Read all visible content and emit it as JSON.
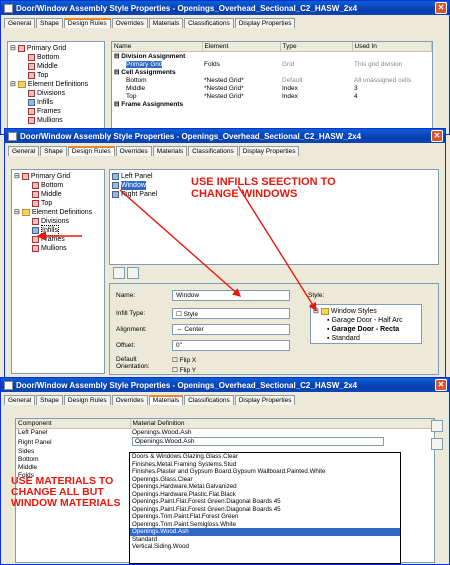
{
  "win1": {
    "title": "Door/Window Assembly Style Properties - Openings_Overhead_Sectional_C2_HASW_2x4",
    "tabs": [
      "General",
      "Shape",
      "Design Rules",
      "Overrides",
      "Materials",
      "Classifications",
      "Display Properties"
    ],
    "tree": [
      "Primary Grid",
      "Bottom",
      "Middle",
      "Top",
      "Element Definitions",
      "Divisions",
      "Infills",
      "Frames",
      "Mullions"
    ],
    "cols": [
      "Name",
      "Element",
      "Type",
      "Used In"
    ],
    "rows": [
      [
        "Division Assignment",
        "",
        "",
        ""
      ],
      [
        "Primary Grid",
        "Folds",
        "Grid",
        "This grid division"
      ],
      [
        "Cell Assignments",
        "",
        "",
        ""
      ],
      [
        "Bottom",
        "*Nested Grid*",
        "Default",
        "All unassigned cells"
      ],
      [
        "Middle",
        "*Nested Grid*",
        "Index",
        "3"
      ],
      [
        "Top",
        "*Nested Grid*",
        "Index",
        "4"
      ],
      [
        "Frame Assignments",
        "",
        "",
        ""
      ]
    ]
  },
  "win2": {
    "title": "Door/Window Assembly Style Properties - Openings_Overhead_Sectional_C2_HASW_2x4",
    "tabs": [
      "General",
      "Shape",
      "Design Rules",
      "Overrides",
      "Materials",
      "Classifications",
      "Display Properties"
    ],
    "tree": [
      "Primary Grid",
      "Bottom",
      "Middle",
      "Top",
      "Element Definitions",
      "Divisions",
      "Infills",
      "Frames",
      "Mullions"
    ],
    "infills": [
      "Left Panel",
      "Window",
      "Right Panel"
    ],
    "note": "USE INFILLS SEECTION TO CHANGE WINDOWS",
    "form": {
      "name_label": "Name:",
      "name": "Window",
      "type_label": "Infill Type:",
      "type": "Style",
      "align_label": "Alignment:",
      "align": "Center",
      "offset_label": "Offset:",
      "offset": "0\"",
      "orient_label": "Default Orientation:",
      "flipx": "Flip X",
      "flipy": "Flip Y",
      "style_label": "Style:"
    },
    "styles": [
      "Window Styles",
      "Garage Door - Half Arc",
      "Garage Door - Recta",
      "Standard"
    ]
  },
  "win3": {
    "title": "Door/Window Assembly Style Properties - Openings_Overhead_Sectional_C2_HASW_2x4",
    "tabs": [
      "General",
      "Shape",
      "Design Rules",
      "Overrides",
      "Materials",
      "Classifications",
      "Display Properties"
    ],
    "cols": [
      "Component",
      "Material Definition"
    ],
    "rows": [
      [
        "Left Panel",
        "Openings.Wood.Ash"
      ],
      [
        "Right Panel",
        "Openings.Wood.Ash"
      ],
      [
        "Sides",
        ""
      ],
      [
        "Bottom",
        ""
      ],
      [
        "Middle",
        ""
      ],
      [
        "Folds",
        ""
      ]
    ],
    "note": "USE MATERIALS TO CHANGE ALL BUT WINDOW MATERIALS",
    "options": [
      "Doors & Windows.Glazing.Glass.Clear",
      "Finishes.Metal.Framing Systems.Stud",
      "Finishes.Plaster and Gypsum Board.Gypsum Wallboard.Painted.White",
      "Openings.Glass.Clear",
      "Openings.Hardware.Metal.Galvanized",
      "Openings.Hardware.Plastic.Flat.Black",
      "Openings.Paint.Flat.Forest Green.Diagonal Boards 45",
      "Openings.Paint.Flat.Forest Green.Diagonal Boards 45",
      "Openings.Trim.Paint.Flat.Forest Green",
      "Openings.Trim.Paint.Semigloss.White",
      "Openings.Wood.Ash",
      "Standard",
      "Vertical.Siding.Wood"
    ],
    "selected_index": 10
  },
  "colors": {
    "note": "#e8180c",
    "title": "#0a4fc6",
    "selection": "#316ac5"
  }
}
